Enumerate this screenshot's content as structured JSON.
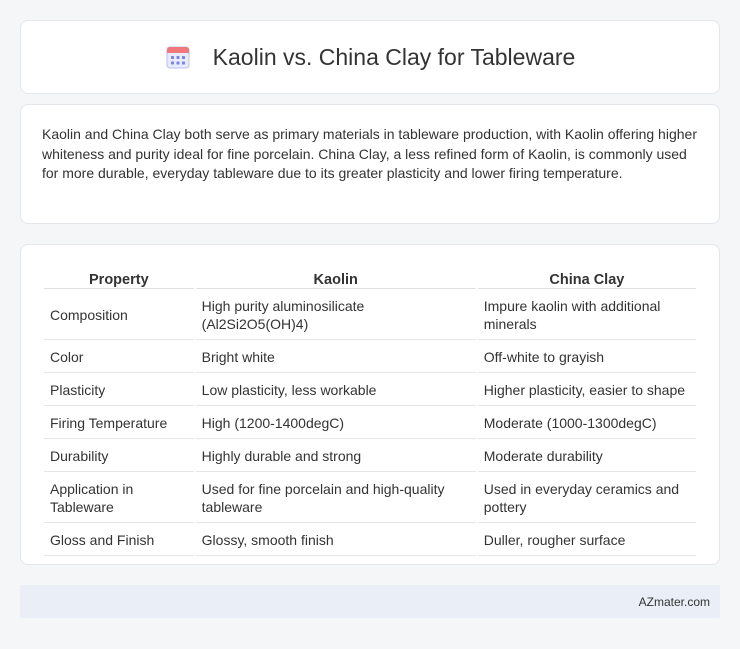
{
  "header": {
    "title": "Kaolin vs. China Clay for Tableware",
    "icon": "calendar-icon"
  },
  "intro": {
    "text": "Kaolin and China Clay both serve as primary materials in tableware production, with Kaolin offering higher whiteness and purity ideal for fine porcelain. China Clay, a less refined form of Kaolin, is commonly used for more durable, everyday tableware due to its greater plasticity and lower firing temperature."
  },
  "table": {
    "headers": [
      "Property",
      "Kaolin",
      "China Clay"
    ],
    "rows": [
      [
        "Composition",
        "High purity aluminosilicate (Al2Si2O5(OH)4)",
        "Impure kaolin with additional minerals"
      ],
      [
        "Color",
        "Bright white",
        "Off-white to grayish"
      ],
      [
        "Plasticity",
        "Low plasticity, less workable",
        "Higher plasticity, easier to shape"
      ],
      [
        "Firing Temperature",
        "High (1200-1400degC)",
        "Moderate (1000-1300degC)"
      ],
      [
        "Durability",
        "Highly durable and strong",
        "Moderate durability"
      ],
      [
        "Application in Tableware",
        "Used for fine porcelain and high-quality tableware",
        "Used in everyday ceramics and pottery"
      ],
      [
        "Gloss and Finish",
        "Glossy, smooth finish",
        "Duller, rougher surface"
      ]
    ]
  },
  "footer": {
    "text": "AZmater.com"
  },
  "colors": {
    "accent": "#7b86e0",
    "icon_top": "#f0787a",
    "footer_bg": "#e9eef7"
  }
}
